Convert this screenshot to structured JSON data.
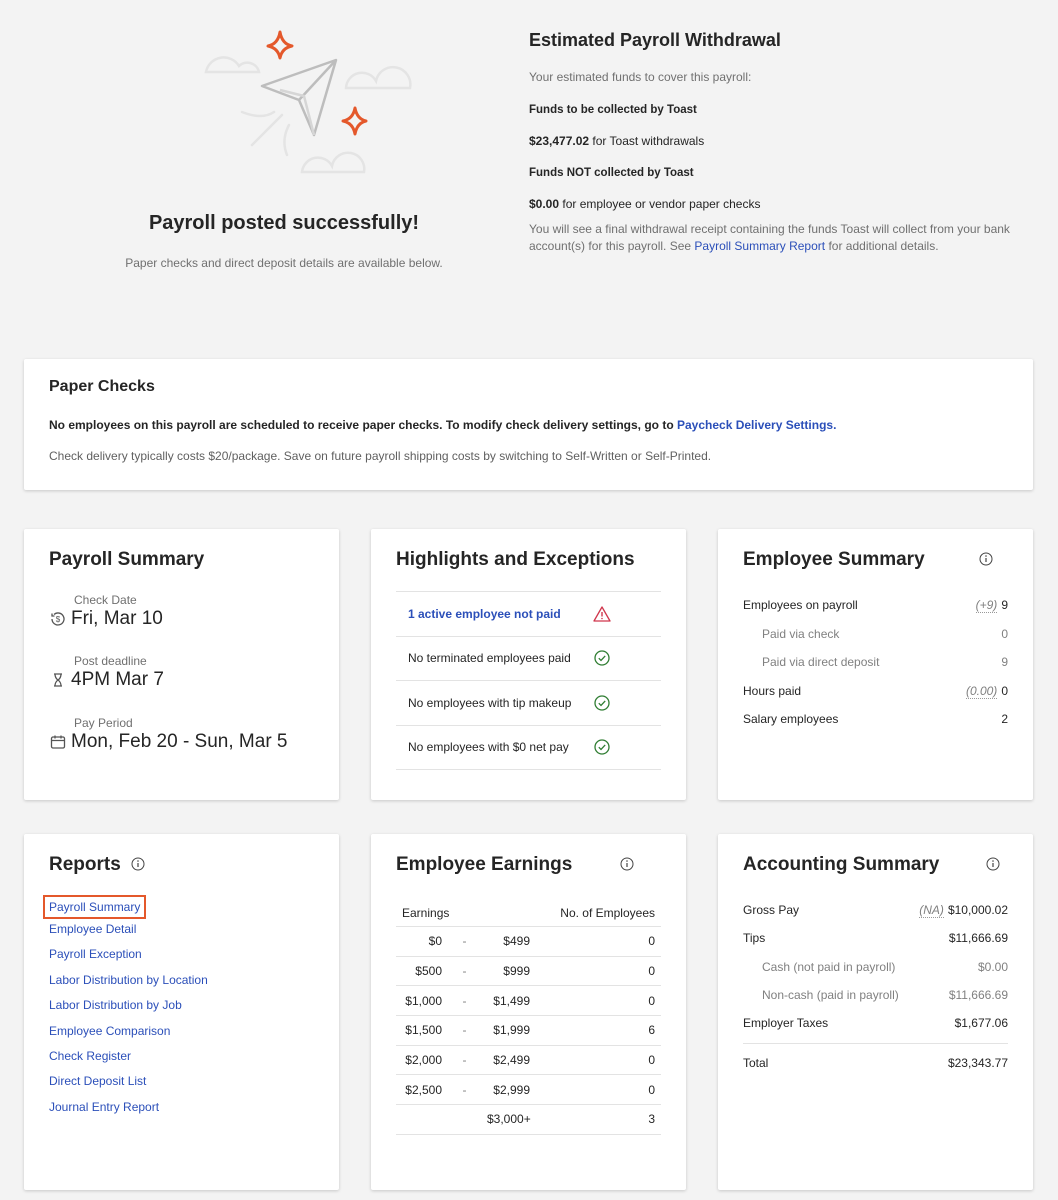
{
  "hero": {
    "title": "Payroll posted successfully!",
    "subtitle": "Paper checks and direct deposit details are available below.",
    "illustration": "paper-plane-icon",
    "accent_color": "#e4582b"
  },
  "withdrawal": {
    "title": "Estimated Payroll Withdrawal",
    "intro": "Your estimated funds to cover this payroll:",
    "collected_heading": "Funds to be collected by Toast",
    "collected_amount": "$23,477.02",
    "collected_suffix": " for Toast withdrawals",
    "not_collected_heading": "Funds NOT collected by Toast",
    "not_collected_amount": "$0.00",
    "not_collected_suffix": " for employee or vendor paper checks",
    "note_before": "You will see a final withdrawal receipt containing the funds Toast will collect from your bank account(s) for this payroll. See ",
    "note_link": "Payroll Summary Report",
    "note_after": " for additional details."
  },
  "paper_checks": {
    "title": "Paper Checks",
    "message": "No employees on this payroll are scheduled to receive paper checks. To modify check delivery settings, go to ",
    "link": "Paycheck Delivery Settings.",
    "note": "Check delivery typically costs $20/package. Save on future payroll shipping costs by switching to Self-Written or Self-Printed."
  },
  "payroll_summary": {
    "title": "Payroll Summary",
    "items": [
      {
        "label": "Check Date",
        "value": "Fri, Mar 10",
        "icon": "dollar-clock-icon"
      },
      {
        "label": "Post deadline",
        "value": "4PM Mar 7",
        "icon": "hourglass-icon"
      },
      {
        "label": "Pay Period",
        "value": "Mon, Feb 20 - Sun, Mar 5",
        "icon": "calendar-icon"
      }
    ]
  },
  "highlights": {
    "title": "Highlights and Exceptions",
    "rows": [
      {
        "text": "1 active employee not paid",
        "status": "warning",
        "link": true
      },
      {
        "text": "No terminated employees paid",
        "status": "ok",
        "link": false
      },
      {
        "text": "No employees with tip makeup",
        "status": "ok",
        "link": false
      },
      {
        "text": "No employees with $0 net pay",
        "status": "ok",
        "link": false
      }
    ],
    "warning_color": "#d0364c",
    "ok_color": "#2f7d32"
  },
  "employee_summary": {
    "title": "Employee Summary",
    "rows": [
      {
        "label": "Employees on payroll",
        "note": "(+9)",
        "value": "9",
        "sub": false
      },
      {
        "label": "Paid via check",
        "note": "",
        "value": "0",
        "sub": true
      },
      {
        "label": "Paid via direct deposit",
        "note": "",
        "value": "9",
        "sub": true
      },
      {
        "label": "Hours paid",
        "note": "(0.00)",
        "value": "0",
        "sub": false
      },
      {
        "label": "Salary employees",
        "note": "",
        "value": "2",
        "sub": false
      }
    ]
  },
  "reports": {
    "title": "Reports",
    "items": [
      "Payroll Summary",
      "Employee Detail",
      "Payroll Exception",
      "Labor Distribution by Location",
      "Labor Distribution by Job",
      "Employee Comparison",
      "Check Register",
      "Direct Deposit List",
      "Journal Entry Report"
    ],
    "highlighted_index": 0
  },
  "employee_earnings": {
    "title": "Employee Earnings",
    "col_earnings": "Earnings",
    "col_count": "No. of Employees",
    "rows": [
      {
        "from": "$0",
        "to": "$499",
        "count": "0"
      },
      {
        "from": "$500",
        "to": "$999",
        "count": "0"
      },
      {
        "from": "$1,000",
        "to": "$1,499",
        "count": "0"
      },
      {
        "from": "$1,500",
        "to": "$1,999",
        "count": "6"
      },
      {
        "from": "$2,000",
        "to": "$2,499",
        "count": "0"
      },
      {
        "from": "$2,500",
        "to": "$2,999",
        "count": "0"
      },
      {
        "from": "",
        "to": "$3,000+",
        "count": "3"
      }
    ]
  },
  "accounting_summary": {
    "title": "Accounting Summary",
    "rows": [
      {
        "label": "Gross Pay",
        "note": "(NA)",
        "value": "$10,000.02",
        "sub": false
      },
      {
        "label": "Tips",
        "note": "",
        "value": "$11,666.69",
        "sub": false
      },
      {
        "label": "Cash (not paid in payroll)",
        "note": "",
        "value": "$0.00",
        "sub": true
      },
      {
        "label": "Non-cash (paid in payroll)",
        "note": "",
        "value": "$11,666.69",
        "sub": true
      },
      {
        "label": "Employer Taxes",
        "note": "",
        "value": "$1,677.06",
        "sub": false
      }
    ],
    "total_label": "Total",
    "total_value": "$23,343.77"
  }
}
